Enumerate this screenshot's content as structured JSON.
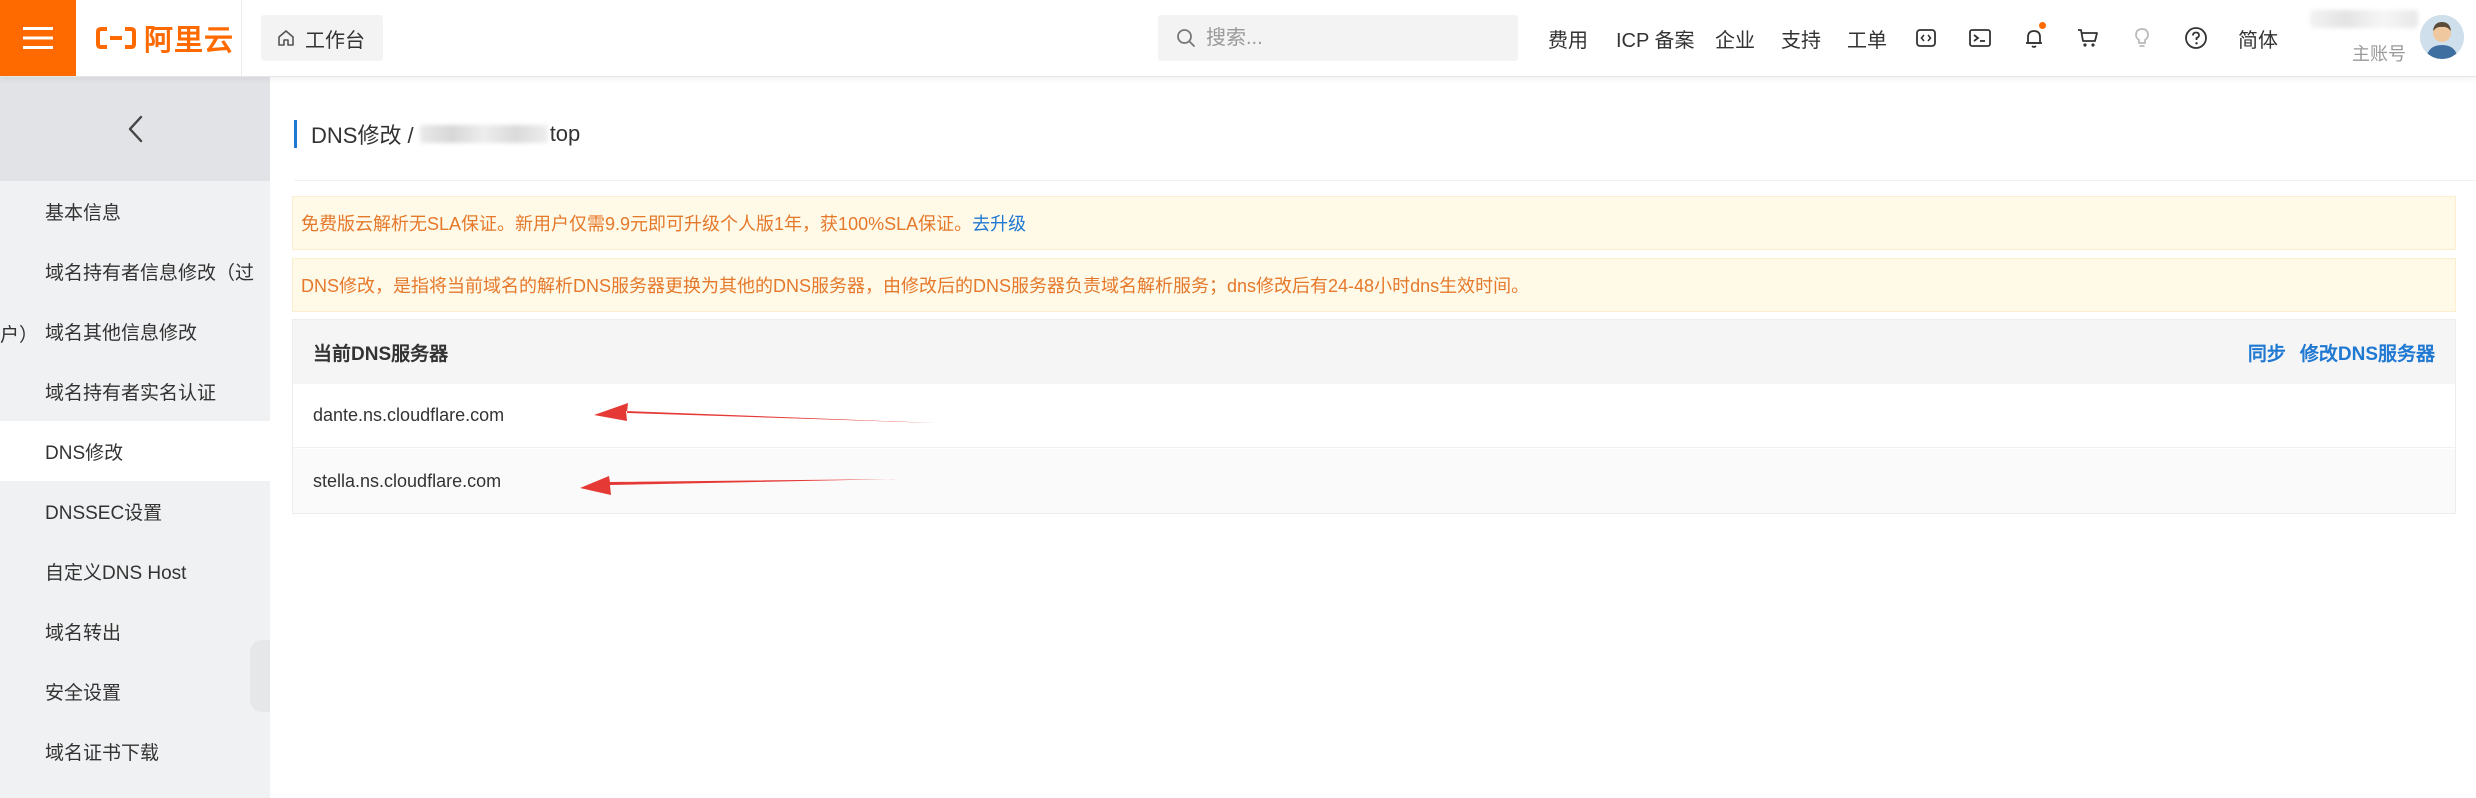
{
  "brand": {
    "logo_text": "阿里云",
    "accent": "#ff6a00",
    "link": "#1f78d1"
  },
  "topbar": {
    "workbench_label": "工作台",
    "search_placeholder": "搜索...",
    "nav": {
      "fees": "费用",
      "icp": "ICP 备案",
      "enterprise": "企业",
      "support": "支持",
      "ticket": "工单",
      "lang": "简体"
    },
    "icons": [
      "code-icon",
      "terminal-icon",
      "bell-icon",
      "cart-icon",
      "bulb-icon",
      "help-icon"
    ],
    "account_label": "主账号"
  },
  "sidebar": {
    "items": [
      {
        "label": "基本信息",
        "active": false
      },
      {
        "label": "域名持有者信息修改（过",
        "active": false
      },
      {
        "label": "域名其他信息修改",
        "active": false
      },
      {
        "label": "域名持有者实名认证",
        "active": false
      },
      {
        "label": "DNS修改",
        "active": true
      },
      {
        "label": "DNSSEC设置",
        "active": false
      },
      {
        "label": "自定义DNS Host",
        "active": false
      },
      {
        "label": "域名转出",
        "active": false
      },
      {
        "label": "安全设置",
        "active": false
      },
      {
        "label": "域名证书下载",
        "active": false
      }
    ],
    "orphan_text": "户）"
  },
  "main": {
    "title_prefix": "DNS修改 /",
    "title_suffix": "top",
    "notice1_text": "免费版云解析无SLA保证。新用户仅需9.9元即可升级个人版1年，获100%SLA保证。",
    "notice1_link": "去升级",
    "notice2_text": "DNS修改，是指将当前域名的解析DNS服务器更换为其他的DNS服务器，由修改后的DNS服务器负责域名解析服务；dns修改后有24-48小时dns生效时间。",
    "dns_panel": {
      "title": "当前DNS服务器",
      "sync_label": "同步",
      "modify_label": "修改DNS服务器",
      "servers": [
        "dante.ns.cloudflare.com",
        "stella.ns.cloudflare.com"
      ]
    }
  },
  "annotation_color": "#e53935"
}
